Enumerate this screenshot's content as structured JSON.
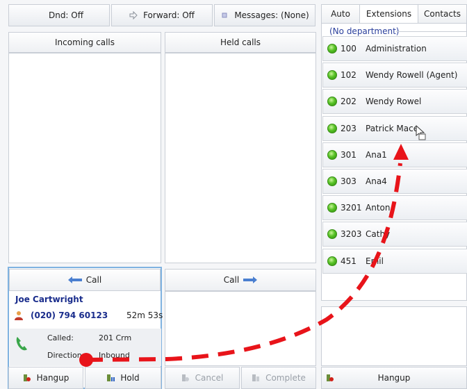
{
  "toolbar": {
    "dnd_label": "Dnd: Off",
    "forward_label": "Forward: Off",
    "messages_label": "Messages: (None)"
  },
  "panels": {
    "incoming_title": "Incoming calls",
    "held_title": "Held calls"
  },
  "call": {
    "header_label": "Call",
    "transfer_label": "Call",
    "caller_name": "Joe Cartwright",
    "caller_number": "(020) 794 60123",
    "duration": "52m 53s",
    "called_label": "Called:",
    "called_value": "201  Crm",
    "direction_label": "Direction:",
    "direction_value": "Inbound"
  },
  "actions": {
    "hangup": "Hangup",
    "hold": "Hold",
    "cancel": "Cancel",
    "complete": "Complete",
    "right_hangup": "Hangup"
  },
  "tabs": [
    {
      "label": "Auto"
    },
    {
      "label": "Extensions"
    },
    {
      "label": "Contacts"
    }
  ],
  "department": "(No department)",
  "extensions": [
    {
      "number": "100",
      "name": "Administration"
    },
    {
      "number": "102",
      "name": "Wendy Rowell (Agent)"
    },
    {
      "number": "202",
      "name": "Wendy Rowel"
    },
    {
      "number": "203",
      "name": "Patrick Mace"
    },
    {
      "number": "301",
      "name": "Ana1"
    },
    {
      "number": "303",
      "name": "Ana4"
    },
    {
      "number": "3201",
      "name": "Anton"
    },
    {
      "number": "3203",
      "name": "Cathy"
    },
    {
      "number": "451",
      "name": "Emil"
    }
  ],
  "colors": {
    "accent_blue": "#1a2d8c",
    "drag_arrow": "#e8141a",
    "status_available": "#57c225"
  }
}
